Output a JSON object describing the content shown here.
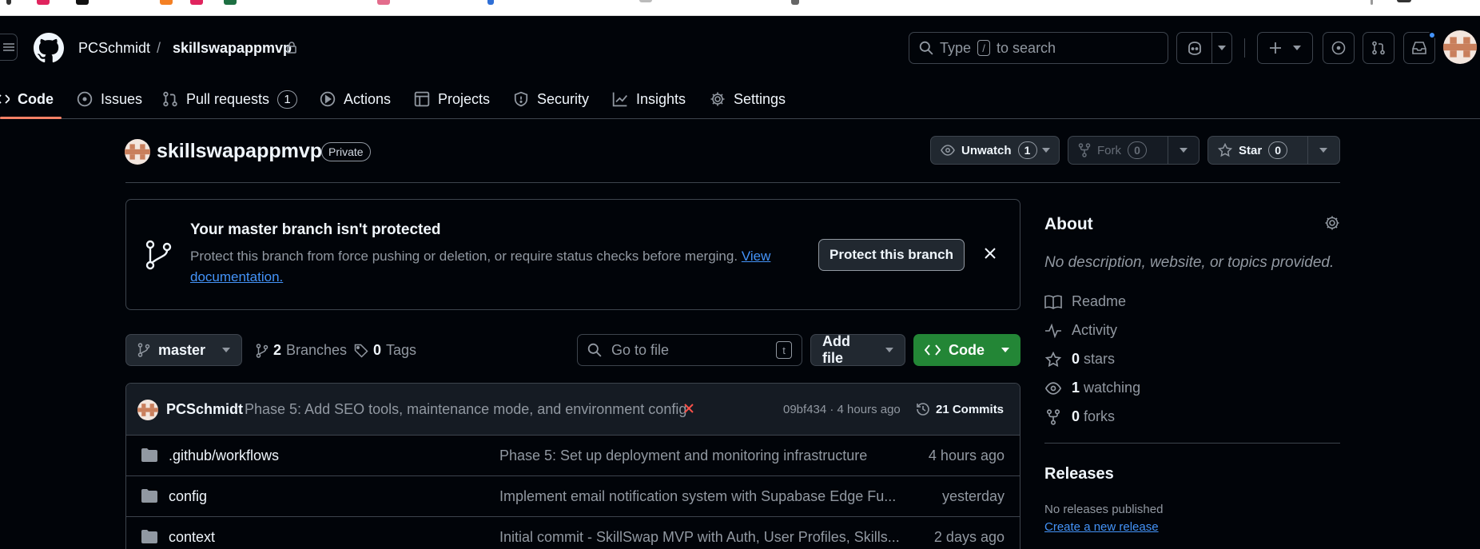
{
  "colors": {
    "bg": "#010409",
    "border": "#3d444d",
    "muted": "#9198a1",
    "text": "#f0f6fc",
    "link": "#4493f8",
    "green": "#238636",
    "danger": "#f85149",
    "accent_underline": "#f78166"
  },
  "header": {
    "owner": "PCSchmidt",
    "separator": "/",
    "repo": "skillswapappmvp",
    "search_prefix": "Type",
    "search_key": "/",
    "search_suffix": "to search"
  },
  "tabs": [
    {
      "label": "Code",
      "icon": "code-icon"
    },
    {
      "label": "Issues",
      "icon": "issue-icon"
    },
    {
      "label": "Pull requests",
      "icon": "pull-request-icon",
      "count": "1"
    },
    {
      "label": "Actions",
      "icon": "play-icon"
    },
    {
      "label": "Projects",
      "icon": "table-icon"
    },
    {
      "label": "Security",
      "icon": "shield-icon"
    },
    {
      "label": "Insights",
      "icon": "graph-icon"
    },
    {
      "label": "Settings",
      "icon": "gear-icon"
    }
  ],
  "repo_header": {
    "name": "skillswapappmvp",
    "visibility": "Private",
    "unwatch_label": "Unwatch",
    "unwatch_count": "1",
    "fork_label": "Fork",
    "fork_count": "0",
    "star_label": "Star",
    "star_count": "0"
  },
  "banner": {
    "title": "Your master branch isn't protected",
    "text": "Protect this branch from force pushing or deletion, or require status checks before merging.",
    "link": "View documentation.",
    "button": "Protect this branch"
  },
  "file_nav": {
    "branch": "master",
    "branches_count": "2",
    "branches_label": "Branches",
    "tags_count": "0",
    "tags_label": "Tags",
    "go_to_file": "Go to file",
    "go_to_file_key": "t",
    "add_file": "Add file",
    "code": "Code"
  },
  "latest_commit": {
    "author": "PCSchmidt",
    "message": "Phase 5: Add SEO tools, maintenance mode, and environment config",
    "meta": "09bf434 · 4 hours ago",
    "commits": "21 Commits"
  },
  "files": [
    {
      "name": ".github/workflows",
      "message": "Phase 5: Set up deployment and monitoring infrastructure",
      "time": "4 hours ago"
    },
    {
      "name": "config",
      "message": "Implement email notification system with Supabase Edge Fu...",
      "time": "yesterday"
    },
    {
      "name": "context",
      "message": "Initial commit - SkillSwap MVP with Auth, User Profiles, Skills...",
      "time": "2 days ago"
    }
  ],
  "about": {
    "title": "About",
    "description": "No description, website, or topics provided.",
    "readme": "Readme",
    "activity": "Activity",
    "stars_count": "0",
    "stars_label": "stars",
    "watching_count": "1",
    "watching_label": "watching",
    "forks_count": "0",
    "forks_label": "forks"
  },
  "releases": {
    "title": "Releases",
    "none": "No releases published",
    "create": "Create a new release"
  }
}
